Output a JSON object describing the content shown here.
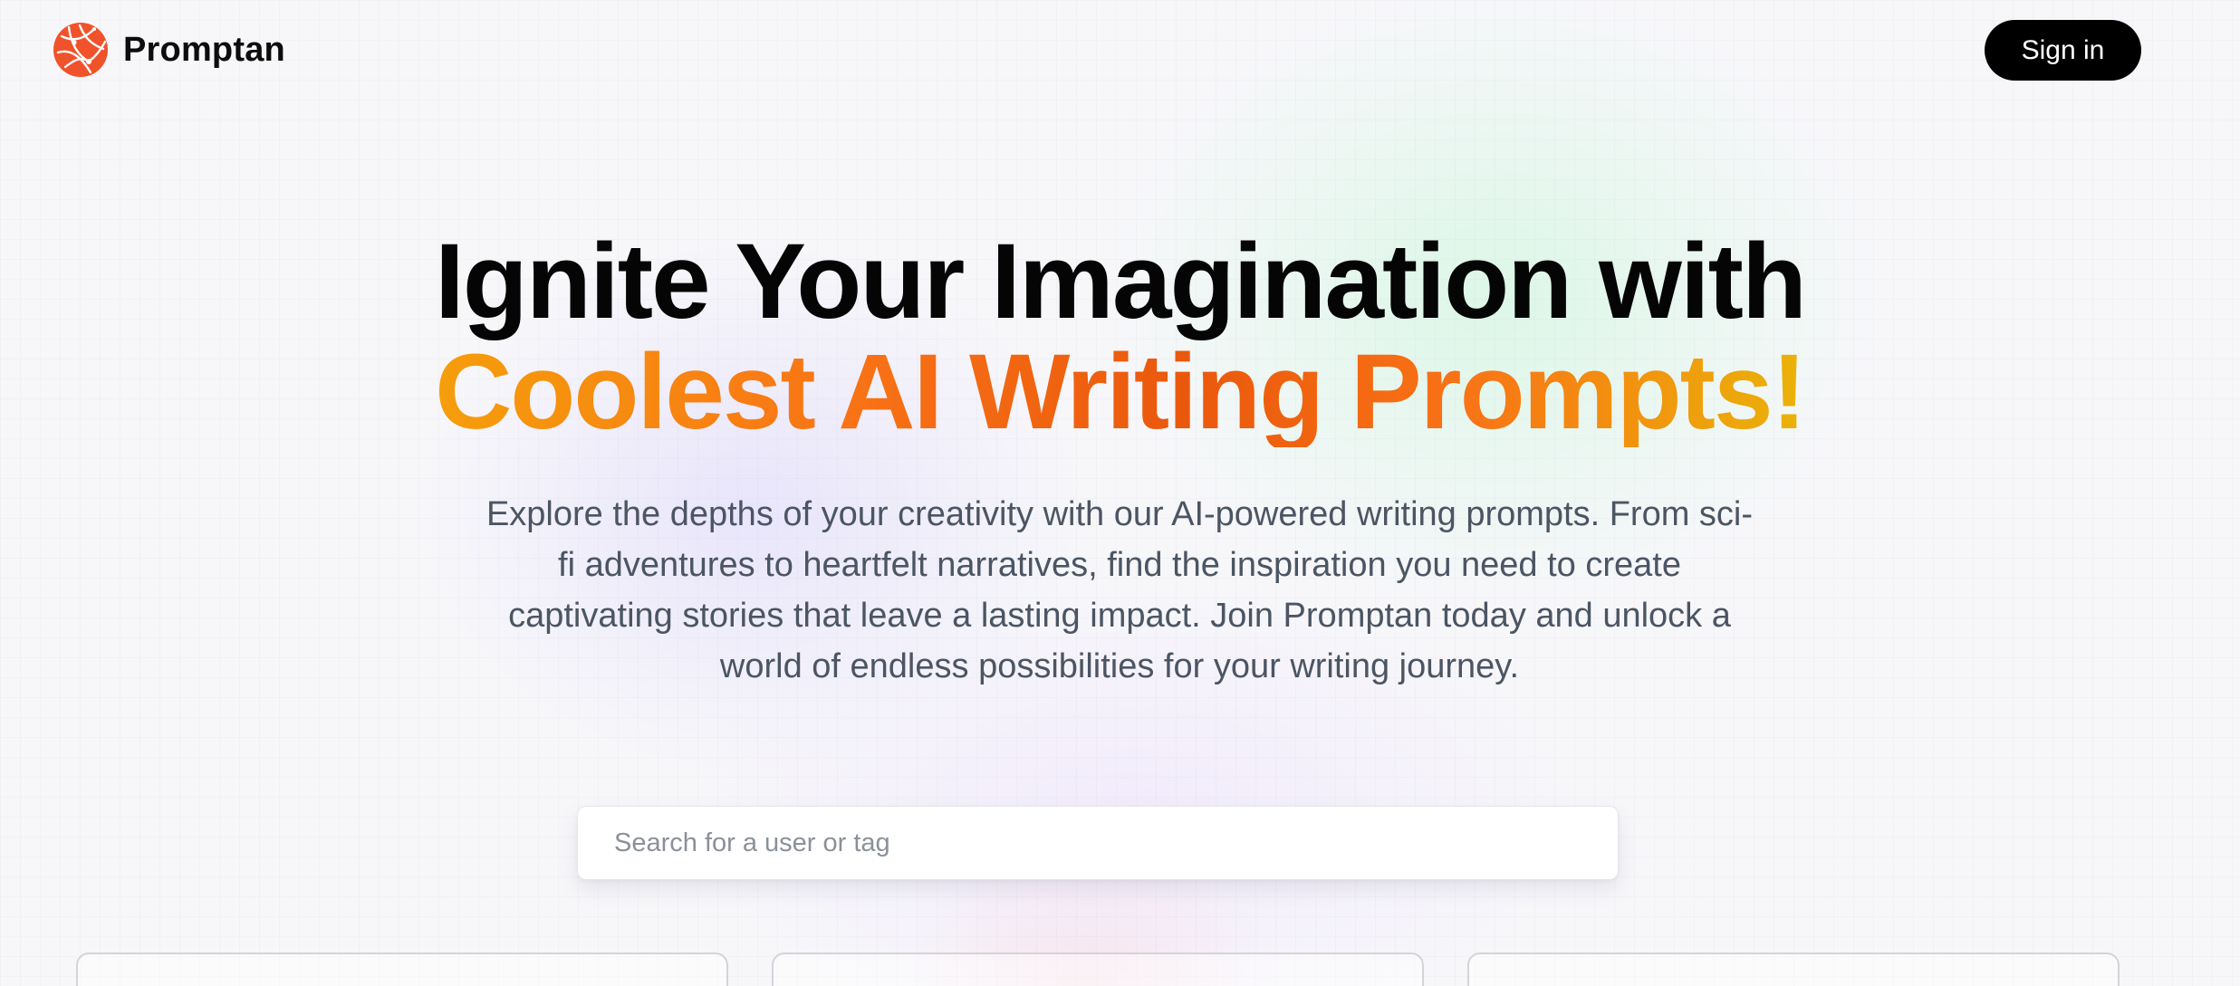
{
  "nav": {
    "brand_name": "Promptan",
    "logo_icon": "globe-network-logo",
    "signin_label": "Sign in"
  },
  "hero": {
    "headline_line1": "Ignite Your Imagination with",
    "headline_line2": "Coolest AI Writing Prompts!",
    "description": "Explore the depths of your creativity with our AI-powered writing prompts. From sci-fi adventures to heartfelt narratives, find the inspiration you need to create captivating stories that leave a lasting impact. Join Promptan today and unlock a world of endless possibilities for your writing journey."
  },
  "search": {
    "placeholder": "Search for a user or tag",
    "value": ""
  },
  "prompt_cards": [
    {},
    {},
    {}
  ],
  "colors": {
    "accent_orange": "#f97316",
    "accent_amber": "#f59e0b",
    "logo_red": "#f0522b",
    "button_bg": "#000000",
    "body_text": "#4b5563"
  }
}
